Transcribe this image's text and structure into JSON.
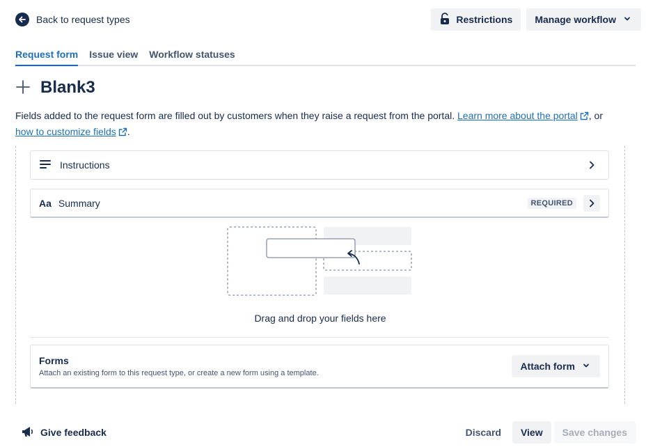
{
  "header": {
    "back_label": "Back to request types",
    "restrictions_label": "Restrictions",
    "manage_workflow_label": "Manage workflow"
  },
  "tabs": [
    {
      "label": "Request form",
      "active": true
    },
    {
      "label": "Issue view",
      "active": false
    },
    {
      "label": "Workflow statuses",
      "active": false
    }
  ],
  "page": {
    "title": "Blank3",
    "description_prefix": "Fields added to the request form are filled out by customers when they raise a request from the portal. ",
    "link_portal": "Learn more about the portal",
    "description_mid": ", or",
    "link_fields": "how to customize fields",
    "description_suffix": "."
  },
  "fields": [
    {
      "icon": "lines-icon",
      "label": "Instructions",
      "badge": ""
    },
    {
      "icon": "text-icon",
      "icon_text": "Aa",
      "label": "Summary",
      "badge": "REQUIRED"
    }
  ],
  "dropzone": {
    "text": "Drag and drop your fields here"
  },
  "forms": {
    "title": "Forms",
    "subtitle": "Attach an existing form to this request type, or create a new form using a template.",
    "attach_label": "Attach form"
  },
  "footer": {
    "feedback_label": "Give feedback",
    "discard_label": "Discard",
    "view_label": "View",
    "save_label": "Save changes"
  },
  "colors": {
    "text": "#172b4d",
    "link": "#1d6fb8",
    "button_bg": "#f1f2f4",
    "border": "#dfe1e6"
  }
}
